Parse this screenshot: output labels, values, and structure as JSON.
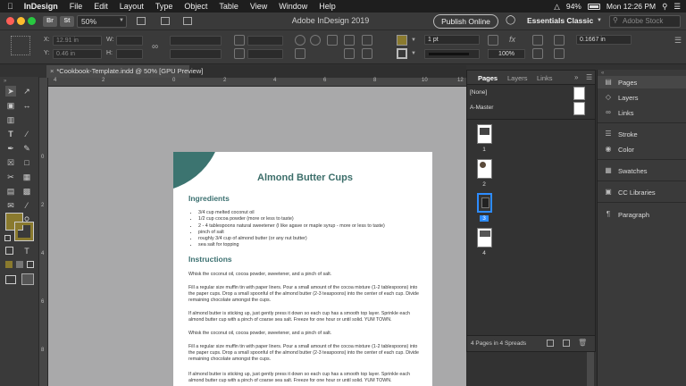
{
  "menubar": {
    "app": "InDesign",
    "items": [
      "File",
      "Edit",
      "Layout",
      "Type",
      "Object",
      "Table",
      "View",
      "Window",
      "Help"
    ],
    "battery": "94%",
    "clock": "Mon 12:26 PM"
  },
  "appbar": {
    "br_label": "Br",
    "st_label": "St",
    "zoom": "50%",
    "title": "Adobe InDesign 2019",
    "publish": "Publish Online",
    "workspace": "Essentials Classic",
    "stock_placeholder": "Adobe Stock"
  },
  "control": {
    "x_value": "12.91 in",
    "y_value": "0.46 in",
    "stroke_weight": "1 pt",
    "opacity": "100%",
    "x_label": "X:",
    "y_label": "Y:",
    "w_label": "W:",
    "h_label": "H:",
    "gap_value": "0.1667 in",
    "fill_color": "#8a7a2e"
  },
  "document_tab": "*Cookbook-Template.indd @ 50% [GPU Preview]",
  "ruler": {
    "h_ticks": [
      "4",
      "2",
      "0",
      "2",
      "4",
      "6",
      "8",
      "10",
      "12"
    ],
    "v_ticks": [
      "0",
      "2",
      "4",
      "6",
      "8"
    ]
  },
  "page": {
    "title": "Almond Butter Cups",
    "ingredients_heading": "Ingredients",
    "ingredients": [
      "3/4 cup melted coconut oil",
      "1/2 cup cocoa powder (more or less to taste)",
      "2 - 4 tablespoons natural sweetener (I like agave or maple syrup - more or less to taste)",
      "pinch of salt",
      "roughly 3/4 cup of almond butter (or any nut butter)",
      "sea salt for topping"
    ],
    "instructions_heading": "Instructions",
    "instructions": [
      "Whisk the coconut oil, cocoa powder, sweetener, and a pinch of salt.",
      "Fill a regular size muffin tin with paper liners. Pour a small amount of the cocoa mixture (1-2 tablespoons) into the paper cups. Drop a small spoonful of the almond butter (2-3 teaspoons) into the center of each cup. Divide remaining chocolate amongst the cups.",
      "If almond butter is sticking up, just gently press it down so each cup has a smooth top layer. Sprinkle each almond butter cup with a pinch of coarse sea salt. Freeze for one hour or until solid. YUM TOWN.",
      "Whisk the coconut oil, cocoa powder, sweetener, and a pinch of salt.",
      "Fill a regular size muffin tin with paper liners. Pour a small amount of the cocoa mixture (1-2 tablespoons) into the paper cups. Drop a small spoonful of the almond butter (2-3 teaspoons) into the center of each cup. Divide remaining chocolate amongst the cups.",
      "If almond butter is sticking up, just gently press it down so each cup has a smooth top layer. Sprinkle each almond butter cup with a pinch of coarse sea salt. Freeze for one hour or until solid. YUM TOWN."
    ],
    "accent_color": "#3c7470"
  },
  "pages_panel": {
    "tabs": [
      "Pages",
      "Layers",
      "Links"
    ],
    "none_label": "[None]",
    "master_label": "A-Master",
    "pages": [
      "1",
      "2",
      "3",
      "4"
    ],
    "selected_page": "3",
    "footer": "4 Pages in 4 Spreads"
  },
  "dock": {
    "items": [
      "Pages",
      "Layers",
      "Links",
      "Stroke",
      "Color",
      "Swatches",
      "CC Libraries",
      "Paragraph"
    ]
  },
  "icons": [
    "apple-icon",
    "wifi-icon",
    "battery-icon",
    "search-icon",
    "lightbulb-icon",
    "selection-tool-icon",
    "type-tool-icon",
    "pen-tool-icon",
    "hand-tool-icon",
    "zoom-tool-icon"
  ]
}
